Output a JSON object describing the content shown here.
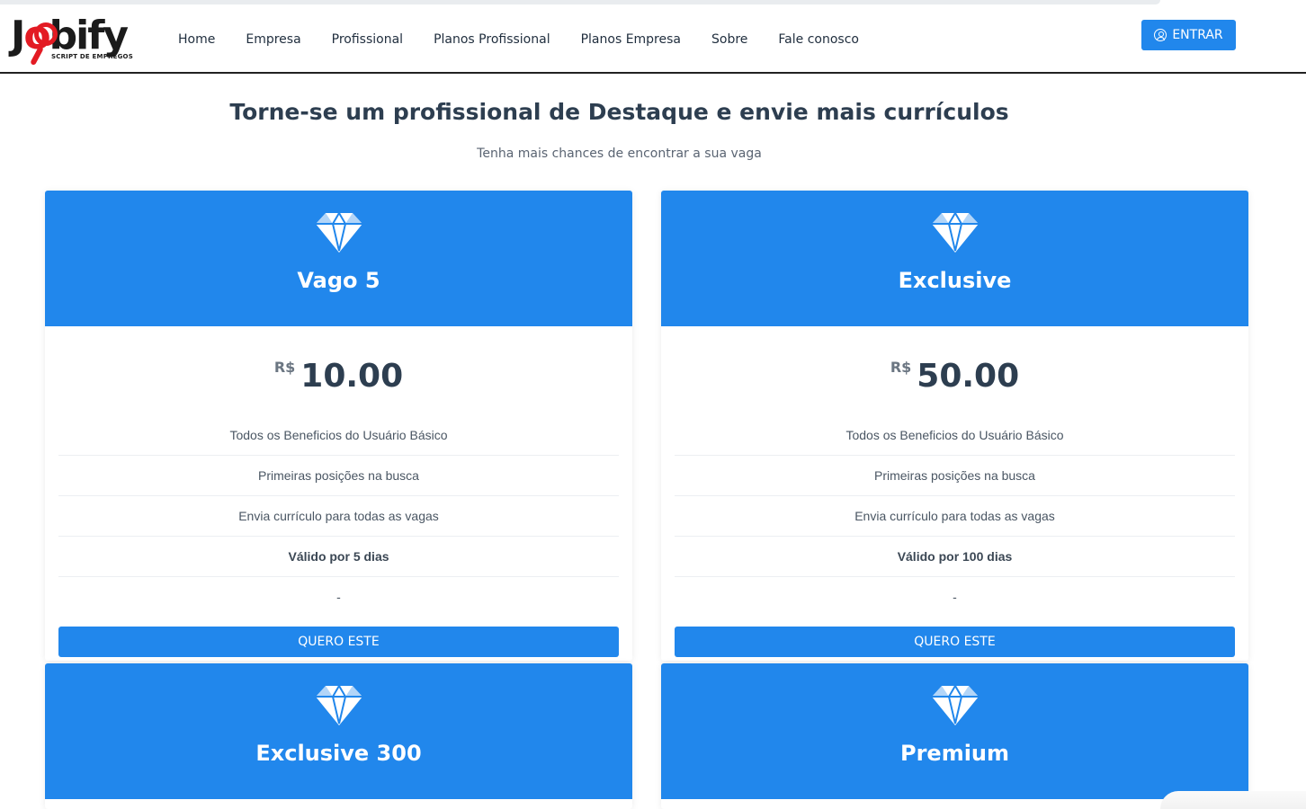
{
  "brand": {
    "logo_word": "Jobify",
    "logo_tag": "SCRIPT DE EMPREGOS"
  },
  "nav": {
    "items": [
      {
        "label": "Home"
      },
      {
        "label": "Empresa"
      },
      {
        "label": "Profissional"
      },
      {
        "label": "Planos Profissional"
      },
      {
        "label": "Planos Empresa"
      },
      {
        "label": "Sobre"
      },
      {
        "label": "Fale conosco"
      }
    ],
    "login_label": "ENTRAR",
    "login_icon": "user-circle-icon"
  },
  "hero": {
    "title": "Torne-se um profissional de Destaque e envie mais currículos",
    "subtitle": "Tenha mais chances de encontrar a sua vaga"
  },
  "plans": [
    {
      "name": "Vago 5",
      "currency": "R$",
      "price": "10.00",
      "icon": "diamond-icon",
      "features": [
        "Todos os Beneficios do Usuário Básico",
        "Primeiras posições na busca",
        "Envia currículo para todas as vagas",
        "Válido por 5 dias",
        "-"
      ],
      "cta": "QUERO ESTE"
    },
    {
      "name": "Exclusive",
      "currency": "R$",
      "price": "50.00",
      "icon": "diamond-icon",
      "features": [
        "Todos os Beneficios do Usuário Básico",
        "Primeiras posições na busca",
        "Envia currículo para todas as vagas",
        "Válido por 100 dias",
        "-"
      ],
      "cta": "QUERO ESTE"
    },
    {
      "name": "Exclusive 300",
      "icon": "diamond-icon"
    },
    {
      "name": "Premium",
      "icon": "diamond-icon"
    }
  ],
  "colors": {
    "primary": "#2187ec",
    "logo_red": "#e31b23",
    "text_dark": "#2d3e50"
  }
}
